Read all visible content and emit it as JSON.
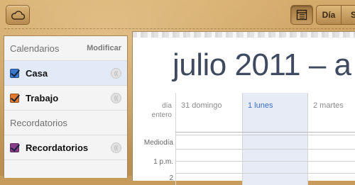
{
  "toolbar": {
    "cloud_icon": "cloud-icon",
    "list_icon": "calendar-list-icon",
    "view_tabs": [
      "Día",
      "S"
    ]
  },
  "sidebar": {
    "calendars_header": "Calendarios",
    "modify_label": "Modificar",
    "calendars": [
      {
        "label": "Casa",
        "color": "#3b78c9",
        "selected": true
      },
      {
        "label": "Trabajo",
        "color": "#e07a2f",
        "selected": false
      }
    ],
    "reminders_header": "Recordatorios",
    "reminders": [
      {
        "label": "Recordatorios",
        "color": "#8a3d8a",
        "selected": false
      }
    ]
  },
  "main": {
    "title": "julio 2011 – a",
    "allday_label": "día\nentero",
    "days": [
      {
        "label": "31 domingo",
        "today": false
      },
      {
        "label": "1 lunes",
        "today": true
      },
      {
        "label": "2 martes",
        "today": false
      }
    ],
    "hours": [
      "Mediodía",
      "1 p.m.",
      "2"
    ]
  }
}
